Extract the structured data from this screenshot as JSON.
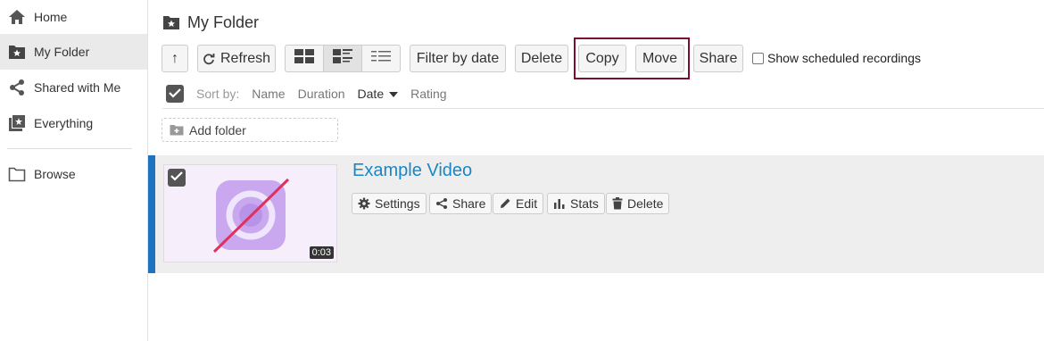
{
  "sidebar": {
    "items": [
      {
        "label": "Home",
        "icon": "home-icon"
      },
      {
        "label": "My Folder",
        "icon": "folder-star-icon",
        "active": true
      },
      {
        "label": "Shared with Me",
        "icon": "share-icon"
      },
      {
        "label": "Everything",
        "icon": "video-library-icon"
      },
      {
        "label": "Browse",
        "icon": "folder-icon"
      }
    ]
  },
  "header": {
    "title": "My Folder"
  },
  "toolbar": {
    "up_label": "↑",
    "refresh_label": "Refresh",
    "filter_label": "Filter by date",
    "delete_label": "Delete",
    "copy_label": "Copy",
    "move_label": "Move",
    "share_label": "Share",
    "scheduled_label": "Show scheduled recordings"
  },
  "sort": {
    "label": "Sort by:",
    "options": [
      "Name",
      "Duration",
      "Date",
      "Rating"
    ],
    "active": "Date"
  },
  "add_folder_label": "Add folder",
  "video": {
    "title": "Example Video",
    "duration": "0:03",
    "actions": [
      "Settings",
      "Share",
      "Edit",
      "Stats",
      "Delete"
    ]
  },
  "colors": {
    "accent": "#1e73be",
    "link": "#1a86c7",
    "highlight": "#7a0f2e"
  }
}
